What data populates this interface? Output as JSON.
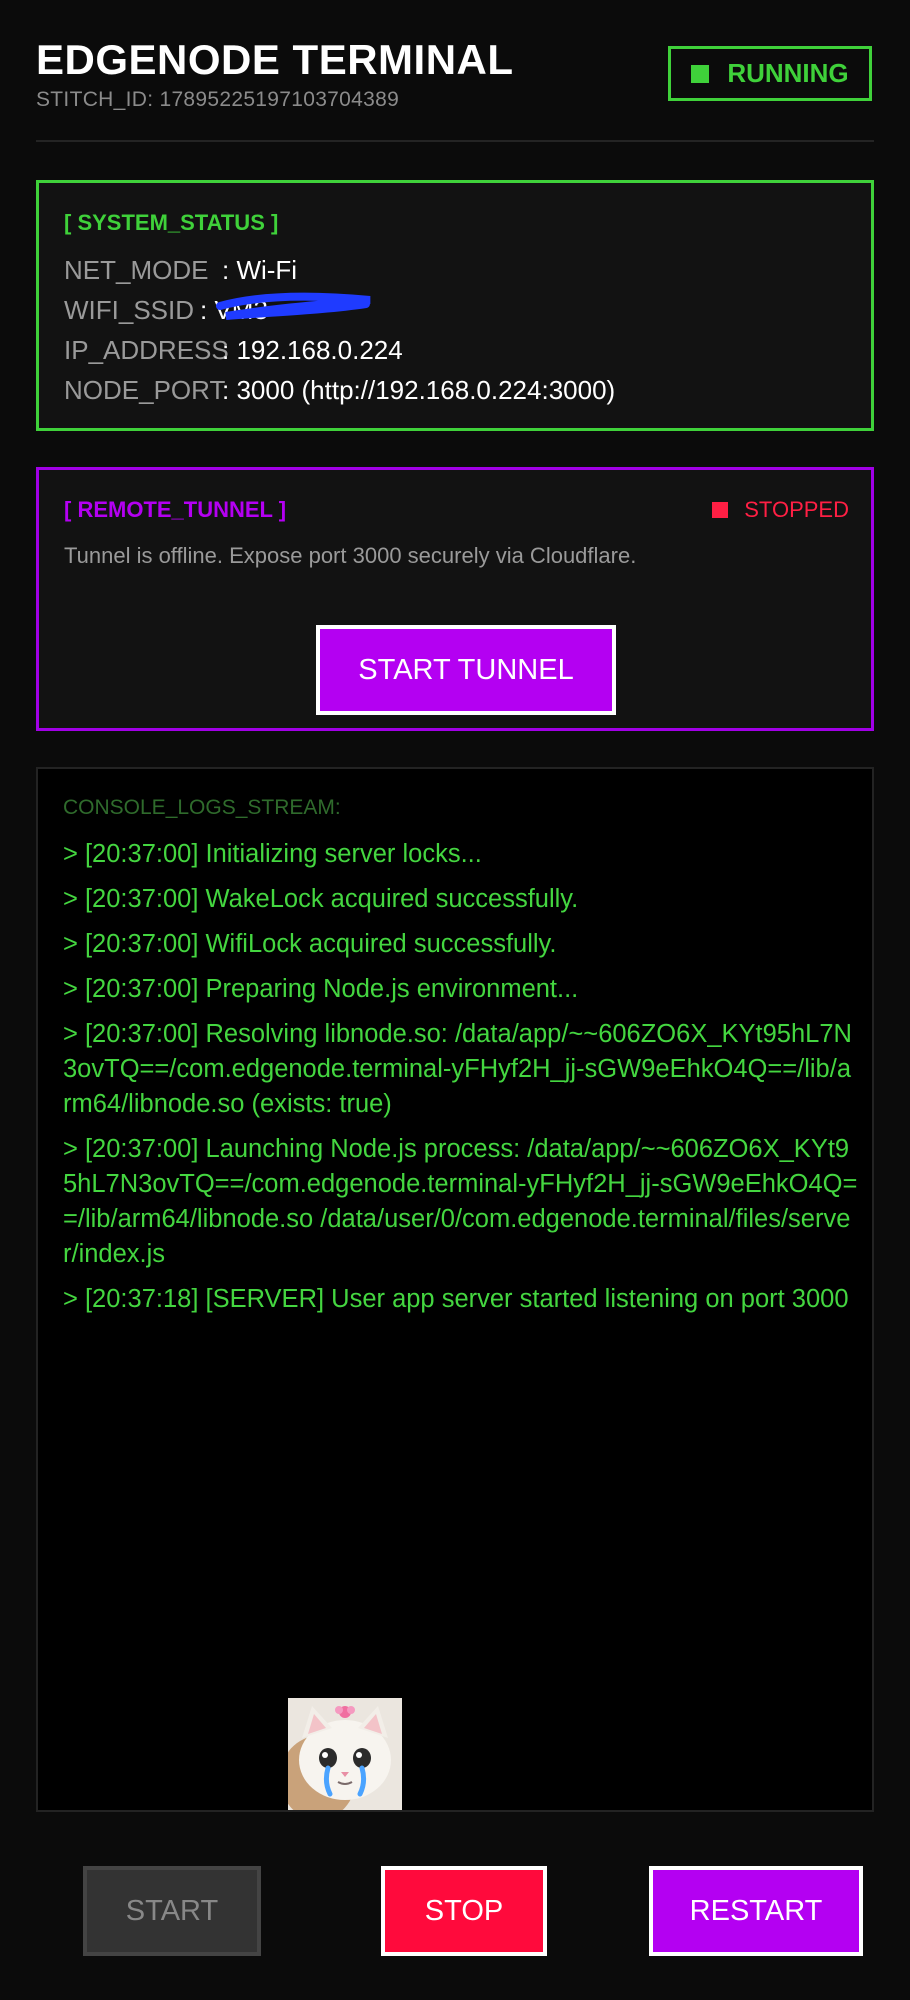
{
  "header": {
    "title": "EDGENODE TERMINAL",
    "stitch_id": "STITCH_ID: 17895225197103704389",
    "status_label": "RUNNING",
    "status_color": "#3fd13a"
  },
  "system_status": {
    "title": "[ SYSTEM_STATUS ]",
    "rows": [
      {
        "key": "NET_MODE",
        "value": ": Wi-Fi"
      },
      {
        "key": "WIFI_SSID",
        "value": ": VM3"
      },
      {
        "key": "IP_ADDRESS",
        "value": ": 192.168.0.224"
      },
      {
        "key": "NODE_PORT",
        "value": ": 3000 (http://192.168.0.224:3000)"
      }
    ]
  },
  "remote_tunnel": {
    "title": "[ REMOTE_TUNNEL ]",
    "status": "STOPPED",
    "status_color": "#ff1f44",
    "description": "Tunnel is offline. Expose port 3000 securely via Cloudflare.",
    "button_label": "START TUNNEL"
  },
  "console": {
    "title": "CONSOLE_LOGS_STREAM:",
    "logs": [
      "> [20:37:00] Initializing server locks...",
      "> [20:37:00] WakeLock acquired successfully.",
      "> [20:37:00] WifiLock acquired successfully.",
      "> [20:37:00] Preparing Node.js environment...",
      "> [20:37:00] Resolving libnode.so: /data/app/~~606ZO6X_KYt95hL7N3ovTQ==/com.edgenode.terminal-yFHyf2H_jj-sGW9eEhkO4Q==/lib/arm64/libnode.so (exists: true)",
      "> [20:37:00] Launching Node.js process: /data/app/~~606ZO6X_KYt95hL7N3ovTQ==/com.edgenode.terminal-yFHyf2H_jj-sGW9eEhkO4Q==/lib/arm64/libnode.so /data/user/0/com.edgenode.terminal/files/server/index.js",
      "> [20:37:18] [SERVER] User app server started listening on port 3000"
    ]
  },
  "controls": {
    "start_label": "START",
    "stop_label": "STOP",
    "restart_label": "RESTART"
  }
}
